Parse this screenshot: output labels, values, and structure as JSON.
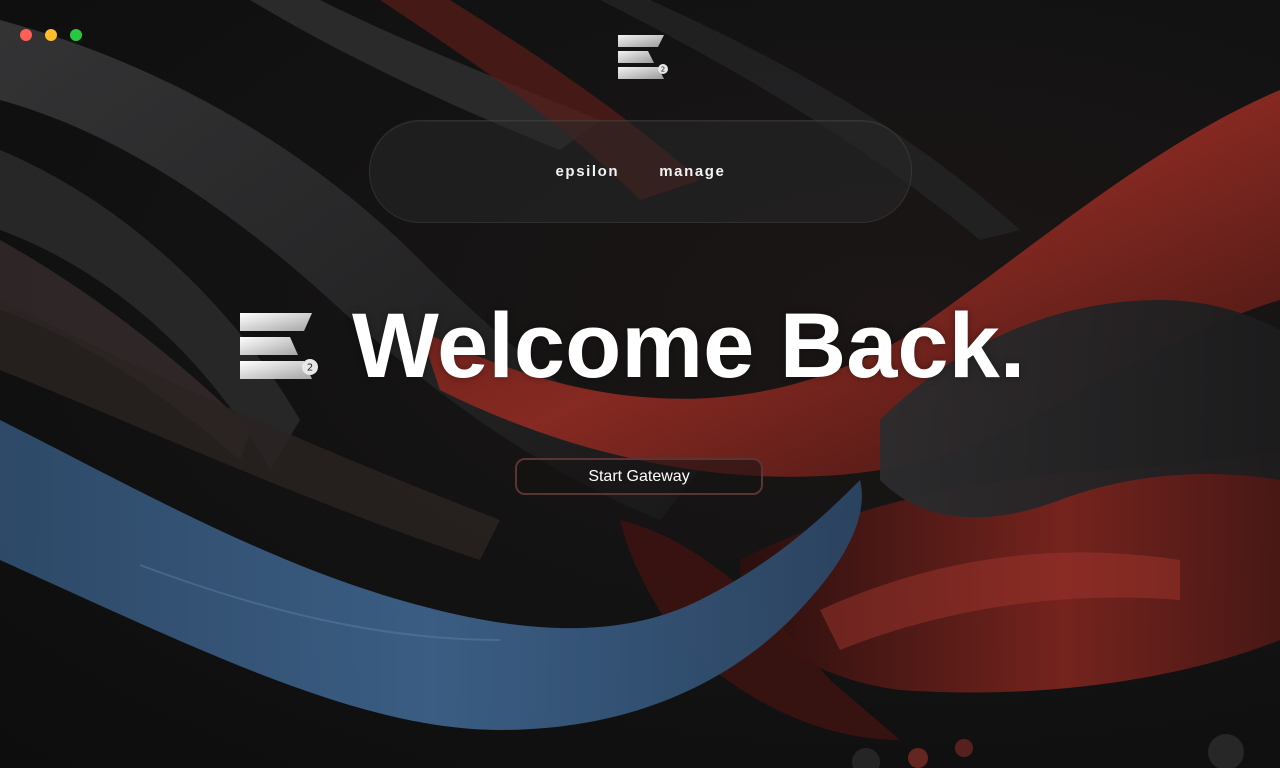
{
  "window": {
    "controls": [
      "close",
      "minimize",
      "maximize"
    ]
  },
  "brand": {
    "logo_icon": "epsilon-stacked-bars-logo",
    "badge_text": "2"
  },
  "nav": {
    "items": [
      {
        "label": "epsilon"
      },
      {
        "label": "manage"
      }
    ]
  },
  "hero": {
    "title": "Welcome Back."
  },
  "cta": {
    "label": "Start Gateway"
  },
  "colors": {
    "background": "#111112",
    "accent_red": "#8a2a22",
    "accent_blue": "#3b5f86",
    "button_border": "#5a3434",
    "text": "#ffffff"
  }
}
